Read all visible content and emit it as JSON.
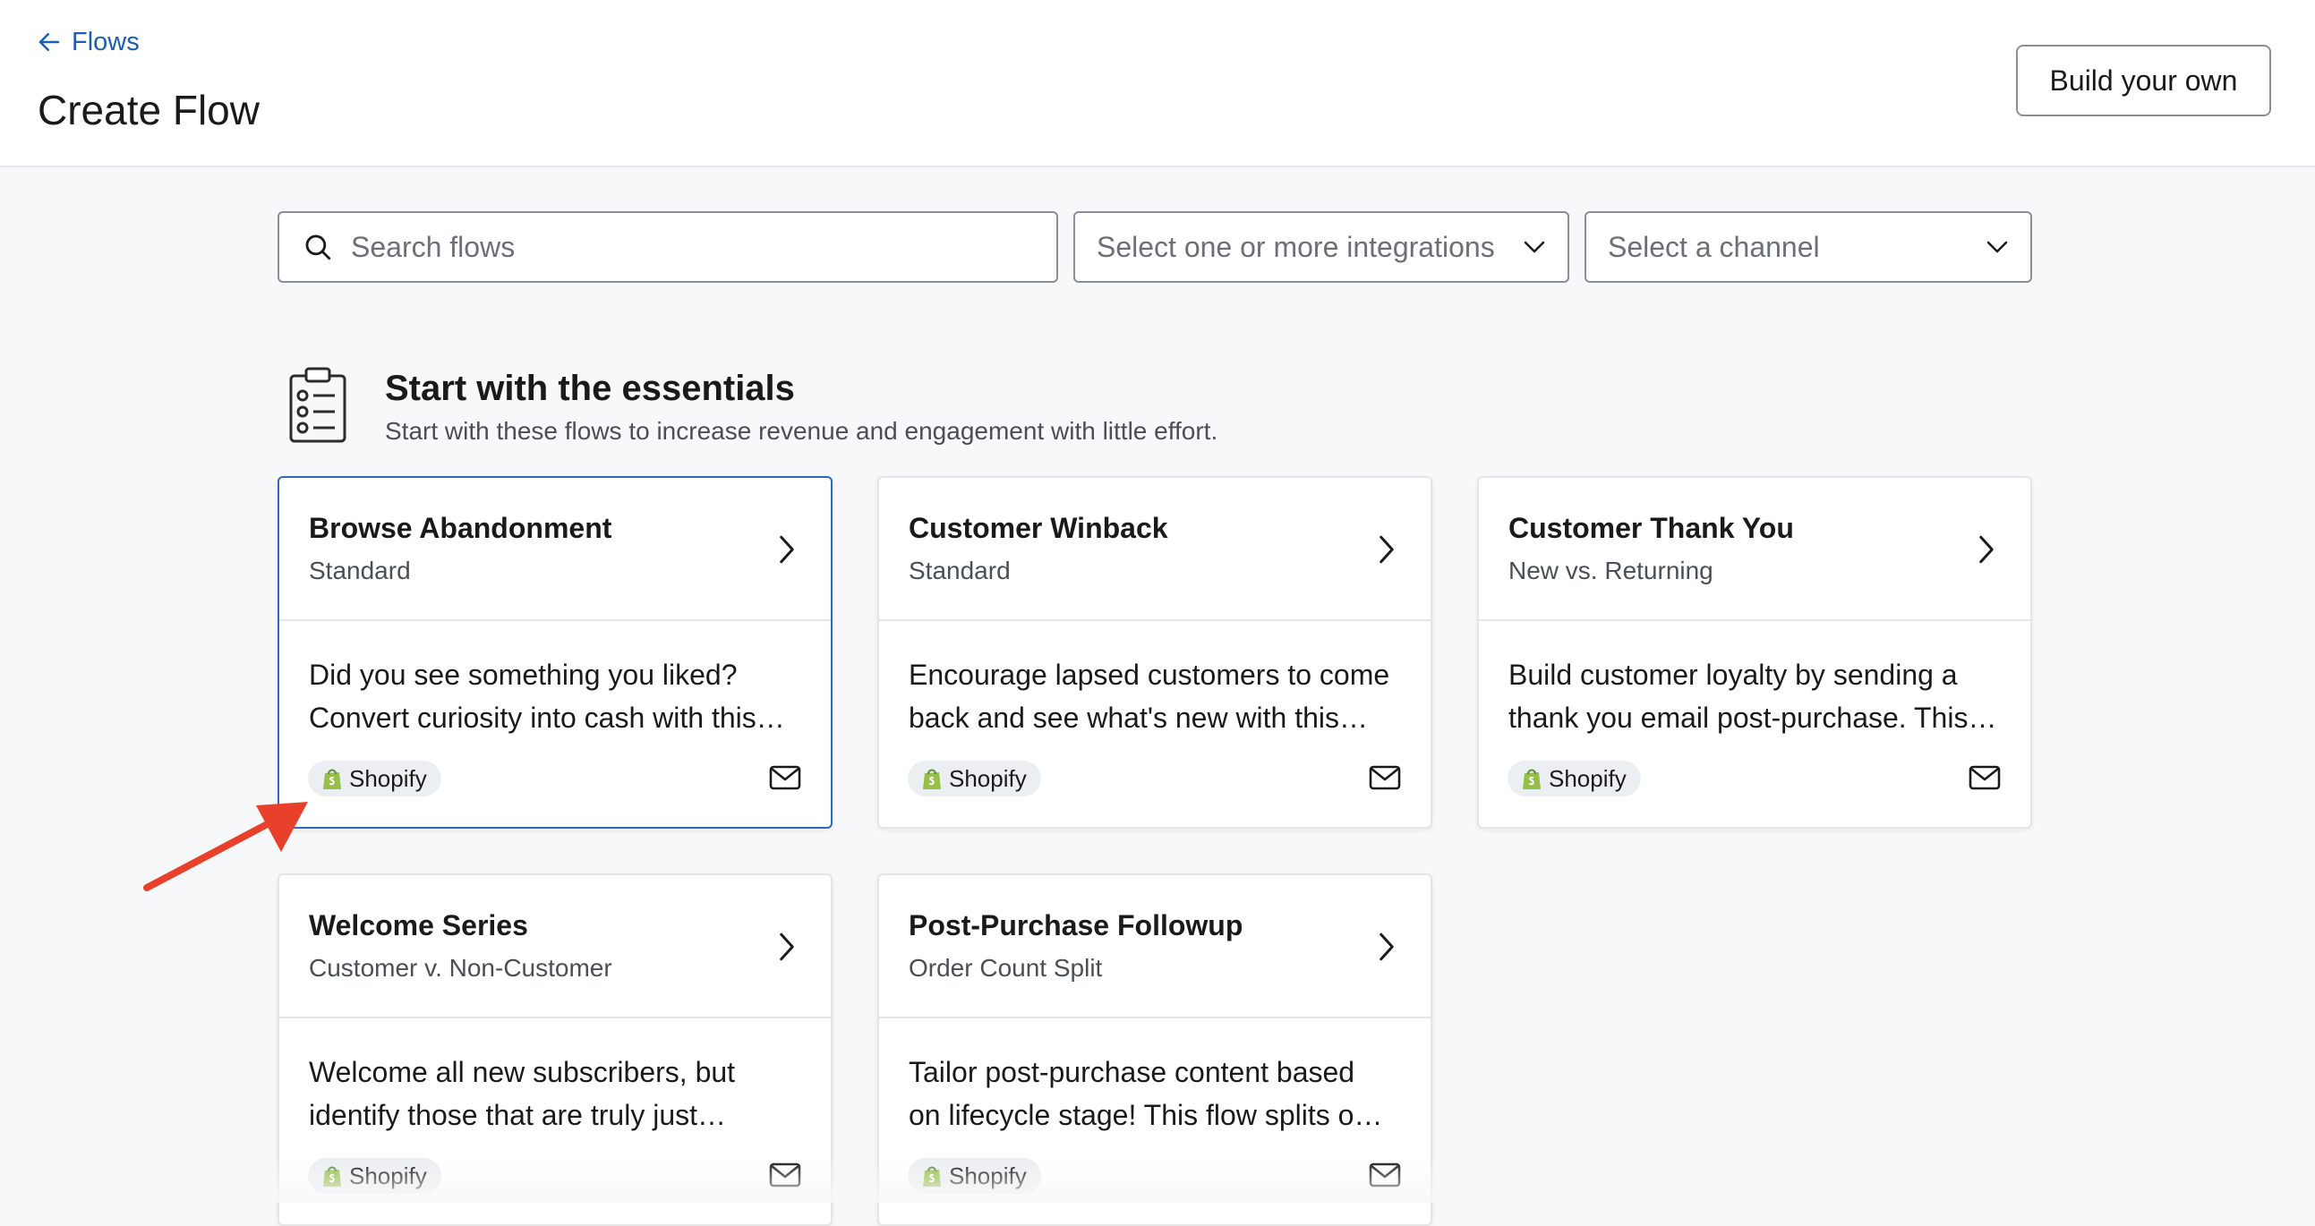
{
  "header": {
    "back_label": "Flows",
    "title": "Create Flow",
    "build_button": "Build your own"
  },
  "filters": {
    "search_placeholder": "Search flows",
    "integrations_placeholder": "Select one or more integrations",
    "channel_placeholder": "Select a channel"
  },
  "section": {
    "title": "Start with the essentials",
    "subtitle": "Start with these flows to increase revenue and engagement with little effort."
  },
  "cards": [
    {
      "title": "Browse Abandonment",
      "subtitle": "Standard",
      "desc_line1": "Did you see something you liked?",
      "desc_line2": "Convert curiosity into cash with this…",
      "integration": "Shopify"
    },
    {
      "title": "Customer Winback",
      "subtitle": "Standard",
      "desc_line1": "Encourage lapsed customers to come",
      "desc_line2": "back and see what's new with this…",
      "integration": "Shopify"
    },
    {
      "title": "Customer Thank You",
      "subtitle": "New vs. Returning",
      "desc_line1": "Build customer loyalty by sending a",
      "desc_line2": "thank you email post-purchase. This…",
      "integration": "Shopify"
    },
    {
      "title": "Welcome Series",
      "subtitle": "Customer v. Non-Customer",
      "desc_line1": "Welcome all new subscribers, but",
      "desc_line2": "identify those that are truly just…",
      "integration": "Shopify"
    },
    {
      "title": "Post-Purchase Followup",
      "subtitle": "Order Count Split",
      "desc_line1": "Tailor post-purchase content based",
      "desc_line2": "on lifecycle stage! This flow splits o…",
      "integration": "Shopify"
    }
  ],
  "colors": {
    "link": "#1d5db0",
    "selected_border": "#2f68c2",
    "shopify_green": "#95bf47",
    "annotation_arrow": "#e8402a"
  },
  "icons": {
    "back": "arrow-left-icon",
    "search": "search-icon",
    "dropdown": "chevron-down-icon",
    "section": "clipboard-checklist-icon",
    "card_open": "chevron-right-icon",
    "integration": "shopify-bag-icon",
    "channel": "mail-icon"
  }
}
